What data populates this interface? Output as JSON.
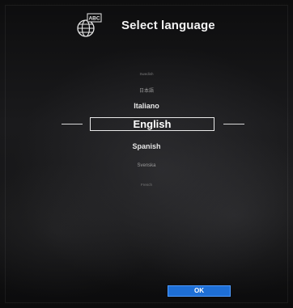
{
  "header": {
    "icon": "globe-abc-icon",
    "icon_badge": "ABC",
    "title": "Select language"
  },
  "languages": [
    {
      "label": "Swedish",
      "size": "far"
    },
    {
      "label": "日本語",
      "size": "mid"
    },
    {
      "label": "Italiano",
      "size": "near"
    },
    {
      "label": "English",
      "selected": true
    },
    {
      "label": "Spanish",
      "size": "near"
    },
    {
      "label": "Svenska",
      "size": "mid"
    },
    {
      "label": "French",
      "size": "far"
    }
  ],
  "ok_button": {
    "label": "OK"
  },
  "colors": {
    "accent": "#1e6fd6",
    "text": "#f2f2f2",
    "background": "#111112"
  }
}
